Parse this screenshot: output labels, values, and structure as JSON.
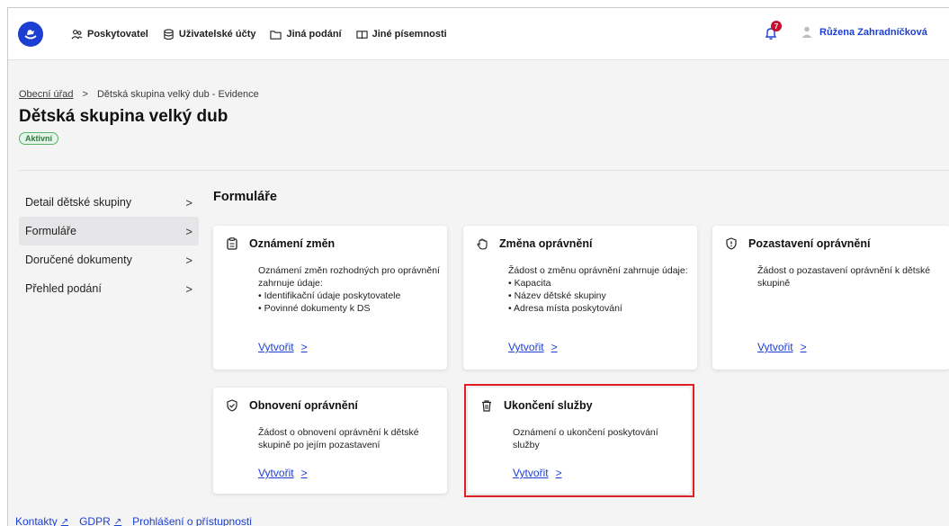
{
  "header": {
    "nav": [
      {
        "label": "Poskytovatel",
        "icon": "people-icon"
      },
      {
        "label": "Uživatelské účty",
        "icon": "database-icon"
      },
      {
        "label": "Jiná podání",
        "icon": "folder-icon"
      },
      {
        "label": "Jiné písemnosti",
        "icon": "book-icon"
      }
    ],
    "notification_count": "7",
    "user_name": "Růžena Zahradníčková"
  },
  "breadcrumb": {
    "parent": "Obecní úřad",
    "separator": ">",
    "current": "Dětská skupina velký dub - Evidence"
  },
  "page": {
    "title": "Dětská skupina velký dub",
    "status": "Aktivní"
  },
  "sidebar": {
    "items": [
      {
        "label": "Detail dětské skupiny"
      },
      {
        "label": "Formuláře"
      },
      {
        "label": "Doručené dokumenty"
      },
      {
        "label": "Přehled podání"
      }
    ]
  },
  "section": {
    "title": "Formuláře"
  },
  "cards": [
    {
      "title": "Oznámení změn",
      "desc": "Oznámení změn rozhodných pro oprávnění zahrnuje údaje:",
      "items": [
        "Identifikační údaje poskytovatele",
        "Povinné dokumenty k DS"
      ],
      "link": "Vytvořit",
      "icon": "clipboard-icon"
    },
    {
      "title": "Změna oprávnění",
      "desc": "Žádost o změnu oprávnění zahrnuje údaje:",
      "items": [
        "Kapacita",
        "Název dětské skupiny",
        "Adresa místa poskytování"
      ],
      "link": "Vytvořit",
      "icon": "hand-icon"
    },
    {
      "title": "Pozastavení oprávnění",
      "desc": "Žádost o pozastavení oprávnění k dětské skupině",
      "items": [],
      "link": "Vytvořit",
      "icon": "shield-alert-icon"
    },
    {
      "title": "Obnovení oprávnění",
      "desc": "Žádost o obnovení oprávnění k dětské skupině po jejím pozastavení",
      "items": [],
      "link": "Vytvořit",
      "icon": "shield-check-icon"
    },
    {
      "title": "Ukončení služby",
      "desc": "Oznámení o ukončení poskytování služby",
      "items": [],
      "link": "Vytvořit",
      "icon": "trash-icon"
    }
  ],
  "footer": {
    "links": [
      {
        "label": "Kontakty"
      },
      {
        "label": "GDPR"
      },
      {
        "label": "Prohlášení o přístupnosti"
      }
    ]
  },
  "colors": {
    "accent": "#1c3fd1",
    "highlight": "#e01e24",
    "status_green": "#58b26a",
    "badge_red": "#c8102e"
  }
}
